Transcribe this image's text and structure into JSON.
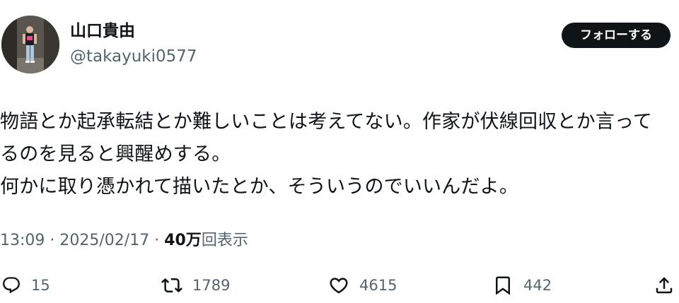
{
  "author": {
    "display_name": "山口貴由",
    "handle": "@takayuki0577"
  },
  "follow_button_label": "フォローする",
  "tweet_lines": [
    "物語とか起承転結とか難しいことは考えてない。作家が伏線回収とか言って",
    "るのを見ると興醒めする。",
    "何かに取り憑かれて描いたとか、そういうのでいいんだよ。"
  ],
  "meta": {
    "time": "13:09",
    "separator": " · ",
    "date": "2025/02/17",
    "views_count": "40万",
    "views_label": "回表示"
  },
  "actions": {
    "reply": {
      "icon": "reply-icon",
      "count": "15"
    },
    "retweet": {
      "icon": "retweet-icon",
      "count": "1789"
    },
    "like": {
      "icon": "heart-icon",
      "count": "4615"
    },
    "bookmark": {
      "icon": "bookmark-icon",
      "count": "442"
    },
    "share": {
      "icon": "share-icon"
    }
  },
  "colors": {
    "text_primary": "#0f1419",
    "text_secondary": "#536471",
    "follow_button_bg": "#0f1419",
    "follow_button_text": "#ffffff"
  }
}
